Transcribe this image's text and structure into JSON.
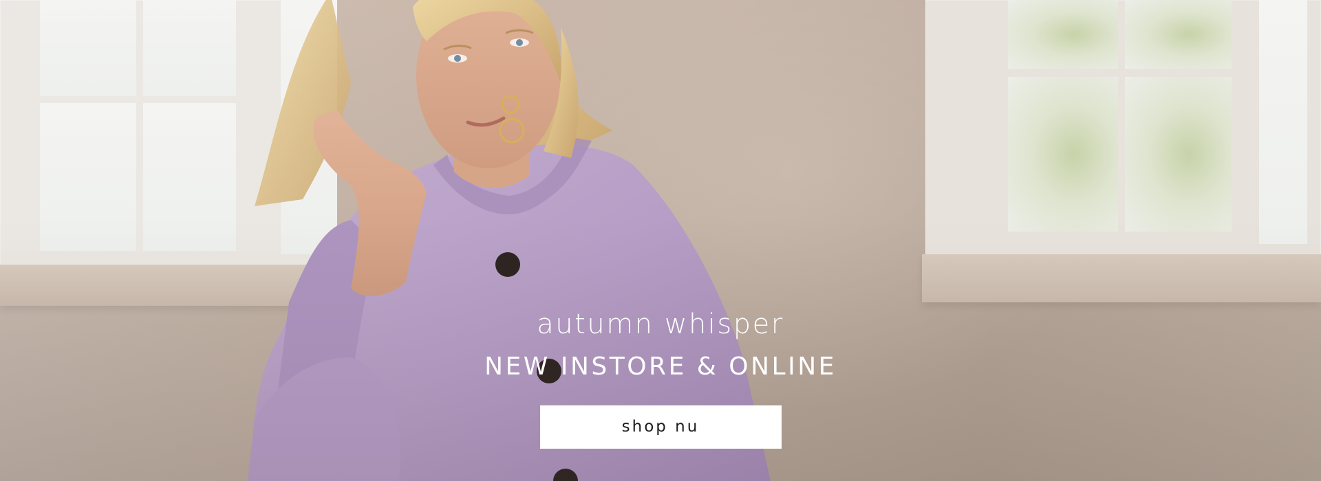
{
  "hero": {
    "subtitle": "autumn whisper",
    "headline": "NEW INSTORE & ONLINE",
    "cta_label": "shop nu",
    "image_subject": "woman-in-lilac-cardigan"
  },
  "colors": {
    "cardigan": "#b9a0c9",
    "wall": "#c4b2a4",
    "text": "#ffffff",
    "button_bg": "#ffffff",
    "button_text": "#1d1d1d"
  }
}
